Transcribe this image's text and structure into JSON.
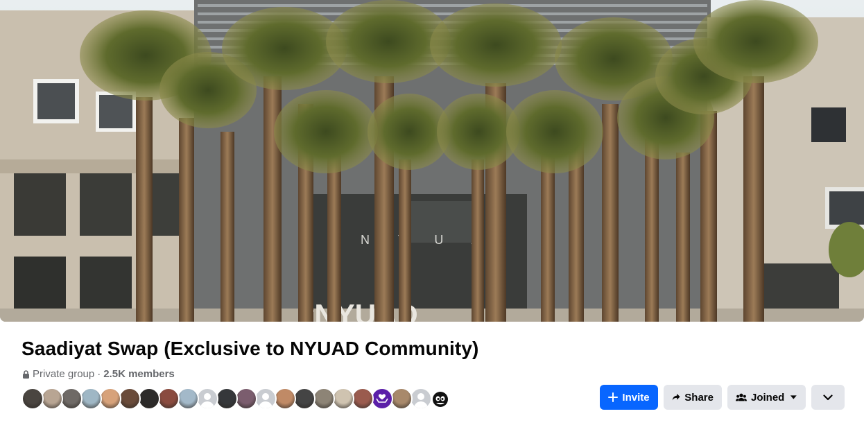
{
  "cover": {
    "image_icon": "cover-photo-nyuad-palm-trees",
    "entrance_letters": "N Y U A",
    "sign_text": "#NYUAD"
  },
  "group": {
    "name": "Saadiyat Swap (Exclusive to NYUAD Community)",
    "privacy_icon": "lock-icon",
    "privacy": "Private group",
    "separator": "·",
    "members": "2.5K members"
  },
  "member_avatars": [
    {
      "icon": "member-avatar",
      "color": "#4a4540"
    },
    {
      "icon": "member-avatar",
      "color": "#b8a593"
    },
    {
      "icon": "member-avatar",
      "color": "#6f6a66"
    },
    {
      "icon": "member-avatar",
      "color": "#9fb7c5"
    },
    {
      "icon": "member-avatar",
      "color": "#d7a27a"
    },
    {
      "icon": "member-avatar",
      "color": "#6a4b3a"
    },
    {
      "icon": "member-avatar",
      "color": "#2d2b2a"
    },
    {
      "icon": "member-avatar",
      "color": "#8a4b3f"
    },
    {
      "icon": "member-avatar",
      "color": "#a3b9c9"
    },
    {
      "icon": "default-silhouette",
      "color": "#c9ccd1"
    },
    {
      "icon": "member-avatar",
      "color": "#35373a"
    },
    {
      "icon": "member-avatar",
      "color": "#7b5d6e"
    },
    {
      "icon": "default-silhouette",
      "color": "#c9ccd1"
    },
    {
      "icon": "member-avatar",
      "color": "#c08a66"
    },
    {
      "icon": "member-avatar",
      "color": "#444444"
    },
    {
      "icon": "member-avatar",
      "color": "#8d8476"
    },
    {
      "icon": "member-avatar",
      "color": "#cfc3b0"
    },
    {
      "icon": "member-avatar",
      "color": "#9a5b4e"
    },
    {
      "icon": "heart-hands-icon",
      "color": "#5b1fa8"
    },
    {
      "icon": "member-avatar",
      "color": "#a8896b"
    },
    {
      "icon": "default-silhouette",
      "color": "#c9ccd1"
    },
    {
      "icon": "cartoon-cat-avatar",
      "color": "#111111"
    }
  ],
  "actions": {
    "invite": {
      "label": "Invite",
      "icon": "plus-icon",
      "color": "#0866ff"
    },
    "share": {
      "label": "Share",
      "icon": "share-arrow-icon"
    },
    "joined": {
      "label": "Joined",
      "icon": "people-icon",
      "caret_icon": "caret-down-icon"
    },
    "more": {
      "icon": "chevron-down-icon"
    }
  }
}
